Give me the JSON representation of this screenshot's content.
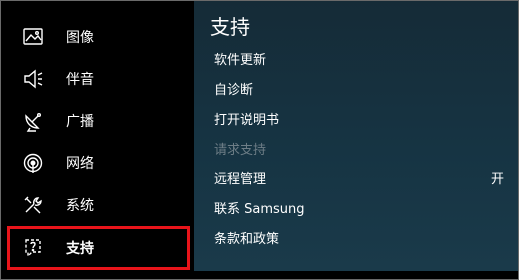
{
  "sidebar": {
    "items": [
      {
        "label": "图像",
        "icon": "picture-icon"
      },
      {
        "label": "伴音",
        "icon": "speaker-icon"
      },
      {
        "label": "广播",
        "icon": "satellite-dish-icon"
      },
      {
        "label": "网络",
        "icon": "network-icon"
      },
      {
        "label": "系统",
        "icon": "tools-icon"
      },
      {
        "label": "支持",
        "icon": "help-icon"
      }
    ],
    "selected_index": 5,
    "selection_color": "#e8141a"
  },
  "panel": {
    "title": "支持",
    "items": [
      {
        "label": "软件更新",
        "value": "",
        "enabled": true
      },
      {
        "label": "自诊断",
        "value": "",
        "enabled": true
      },
      {
        "label": "打开说明书",
        "value": "",
        "enabled": true
      },
      {
        "label": "请求支持",
        "value": "",
        "enabled": false
      },
      {
        "label": "远程管理",
        "value": "开",
        "enabled": true
      },
      {
        "label": "联系 Samsung",
        "value": "",
        "enabled": true
      },
      {
        "label": "条款和政策",
        "value": "",
        "enabled": true
      }
    ]
  },
  "colors": {
    "background": "#000000",
    "panel": "#163443",
    "disabled_text": "#6d7d86"
  }
}
